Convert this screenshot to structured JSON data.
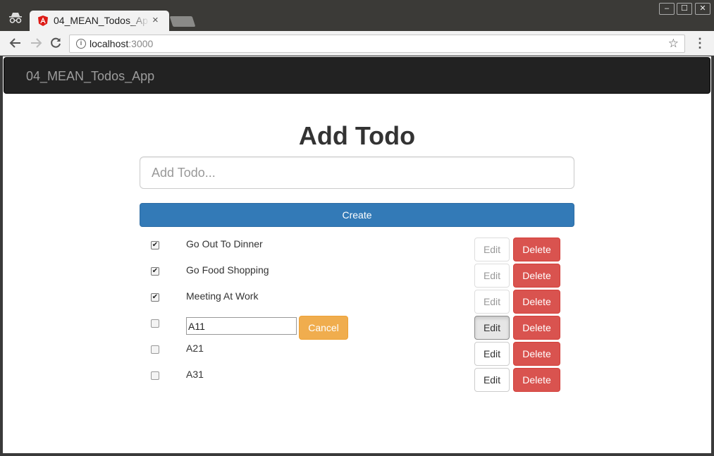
{
  "browser": {
    "tab_title": "04_MEAN_Todos_App",
    "tab_close": "×",
    "url_host": "localhost",
    "url_port": ":3000",
    "window_buttons": [
      "–",
      "☐",
      "✕"
    ],
    "icons": [
      "incognito-icon",
      "angular-icon",
      "back-arrow-icon",
      "forward-arrow-icon",
      "reload-icon",
      "info-icon",
      "star-icon",
      "menu-dots-icon"
    ]
  },
  "app": {
    "brand": "04_MEAN_Todos_App",
    "heading": "Add Todo",
    "input_placeholder": "Add Todo...",
    "create_label": "Create",
    "edit_label": "Edit",
    "delete_label": "Delete",
    "cancel_label": "Cancel"
  },
  "todos": [
    {
      "text": "Go Out To Dinner",
      "done": true
    },
    {
      "text": "Go Food Shopping",
      "done": true
    },
    {
      "text": "Meeting At Work",
      "done": true
    },
    {
      "text": "A11",
      "done": false,
      "editing": true
    },
    {
      "text": "A21",
      "done": false
    },
    {
      "text": "A31",
      "done": false
    }
  ],
  "colors": {
    "primary": "#337ab7",
    "danger": "#d9534f",
    "warning": "#f0ad4e",
    "navbar": "#222222"
  }
}
